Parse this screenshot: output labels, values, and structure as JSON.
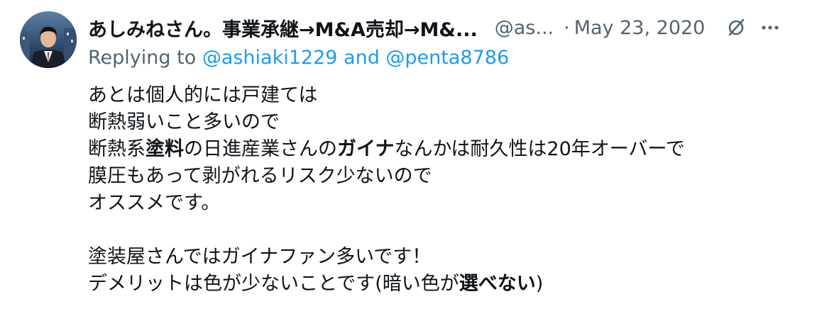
{
  "tweet": {
    "author": {
      "display_name": "あしみねさん。事業承継→M&A売却→M&...",
      "handle": "@as...",
      "avatar_icon": "avatar-photo"
    },
    "separator": "·",
    "date": "May 23, 2020",
    "icons": {
      "edited": "slashed-circle-icon",
      "more": "more-icon"
    },
    "reply": {
      "prefix": "Replying to",
      "mention1": "@ashiaki1229",
      "conjunction": "and",
      "mention2": "@penta8786"
    },
    "body": {
      "line1": "あとは個人的には戸建ては",
      "line2": "断熱弱いこと多いので",
      "line3_a": "断熱系",
      "line3_b": "塗料",
      "line3_c": "の日進産業さんの",
      "line3_d": "ガイナ",
      "line3_e": "なんかは耐久性は20年オーバーで",
      "line4": "膜圧もあって剥がれるリスク少ないので",
      "line5": "オススメです。",
      "line7": "塗装屋さんではガイナファン多いです！",
      "line8_a": "デメリットは色が少ないことです(暗い色が",
      "line8_b": "選べない",
      "line8_c": ")"
    },
    "colors": {
      "text": "#0f1419",
      "muted": "#536471",
      "link": "#1d9bf0"
    }
  }
}
